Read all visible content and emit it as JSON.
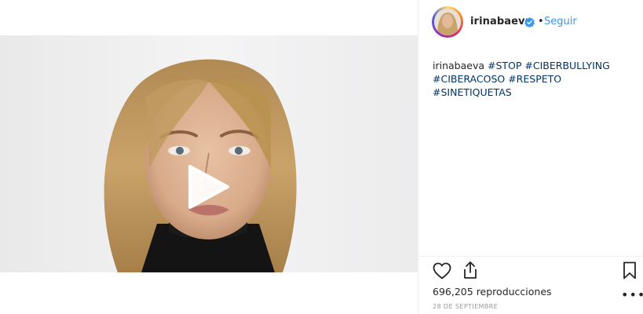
{
  "post": {
    "username": "irinabaeva",
    "dot": "•",
    "follow_label": "Seguir",
    "caption_user": "irinabaeva",
    "hashtags": [
      "#STOP",
      "#CIBERBULLYING",
      "#CIBERACOSO",
      "#RESPETO",
      "#SINETIQUETAS"
    ],
    "views_count": "696,205",
    "views_label": "reproducciones",
    "date": "28 DE SEPTIEMBRE",
    "more_label": "•••"
  },
  "colors": {
    "link": "#3897f0",
    "hashtag": "#003569",
    "text": "#262626",
    "muted": "#999999"
  },
  "icons": {
    "like": "heart-icon",
    "share": "share-icon",
    "save": "bookmark-icon",
    "verified": "verified-badge-icon",
    "play": "play-icon"
  }
}
